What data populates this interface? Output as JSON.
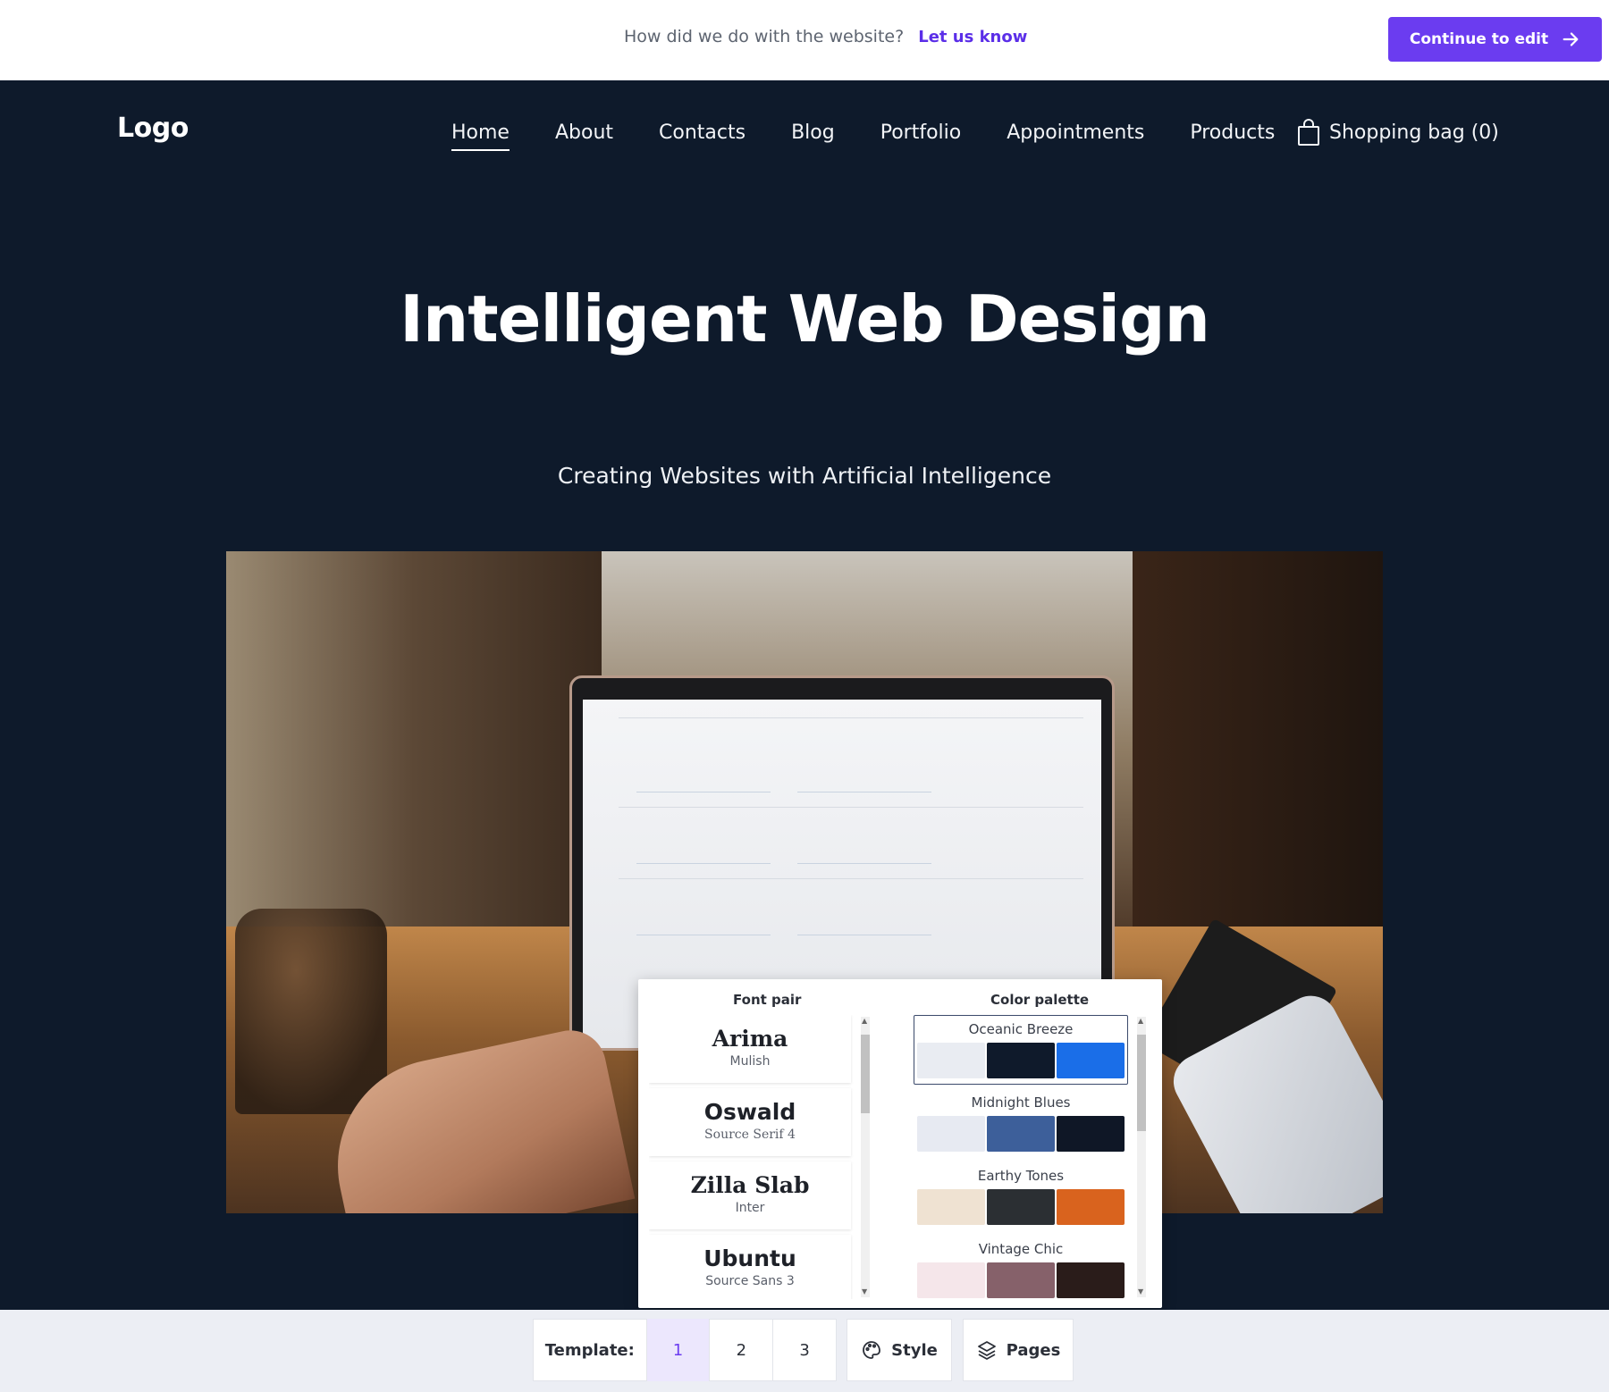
{
  "feedback_bar": {
    "question": "How did we do with the website?",
    "link": "Let us know",
    "cta_label": "Continue to edit"
  },
  "header": {
    "logo": "Logo",
    "nav": [
      "Home",
      "About",
      "Contacts",
      "Blog",
      "Portfolio",
      "Appointments",
      "Products"
    ],
    "active_nav": "Home",
    "bag_label": "Shopping bag (0)"
  },
  "hero": {
    "title": "Intelligent Web Design",
    "subtitle": "Creating Websites with Artificial Intelligence"
  },
  "style_panel": {
    "font_pair_title": "Font pair",
    "color_palette_title": "Color palette",
    "font_pairs": [
      {
        "heading": "Arima",
        "body": "Mulish"
      },
      {
        "heading": "Oswald",
        "body": "Source Serif 4"
      },
      {
        "heading": "Zilla Slab",
        "body": "Inter"
      },
      {
        "heading": "Ubuntu",
        "body": "Source Sans 3"
      }
    ],
    "palettes": [
      {
        "name": "Oceanic Breeze",
        "colors": [
          "#e9ecf2",
          "#0f1a2b",
          "#1a6ee8"
        ],
        "selected": true
      },
      {
        "name": "Midnight Blues",
        "colors": [
          "#e7eaf2",
          "#3d5f9a",
          "#0f1726"
        ],
        "selected": false
      },
      {
        "name": "Earthy Tones",
        "colors": [
          "#efe2d2",
          "#2b2f33",
          "#d9631e"
        ],
        "selected": false
      },
      {
        "name": "Vintage Chic",
        "colors": [
          "#f5e6ea",
          "#86616a",
          "#2a1c1a"
        ],
        "selected": false
      }
    ]
  },
  "toolbar": {
    "template_label": "Template:",
    "templates": [
      "1",
      "2",
      "3"
    ],
    "active_template": "1",
    "style_label": "Style",
    "pages_label": "Pages"
  },
  "colors": {
    "accent": "#6b3cf0",
    "site_bg": "#0e1a2b"
  },
  "icons": {
    "cta": "arrow-right-icon",
    "bag": "shopping-bag-icon",
    "style": "palette-icon",
    "pages": "layers-icon"
  }
}
